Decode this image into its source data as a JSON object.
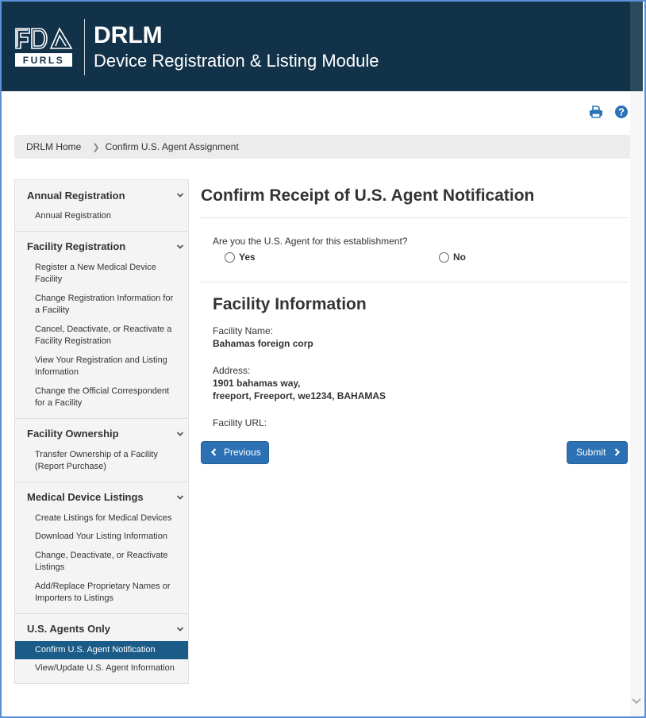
{
  "header": {
    "logo_top": "FDA",
    "logo_bottom": "FURLS",
    "title": "DRLM",
    "subtitle": "Device Registration & Listing Module"
  },
  "toolbar": {
    "print_icon": "print-icon",
    "help_icon": "help-icon"
  },
  "breadcrumb": {
    "items": [
      {
        "label": "DRLM Home"
      },
      {
        "label": "Confirm U.S. Agent Assignment"
      }
    ]
  },
  "sidebar": {
    "groups": [
      {
        "title": "Annual Registration",
        "items": [
          {
            "label": "Annual Registration"
          }
        ]
      },
      {
        "title": "Facility Registration",
        "items": [
          {
            "label": "Register a New Medical Device Facility"
          },
          {
            "label": "Change Registration Information for a Facility"
          },
          {
            "label": "Cancel, Deactivate, or Reactivate a Facility Registration"
          },
          {
            "label": "View Your Registration and Listing Information"
          },
          {
            "label": "Change the Official Correspondent for a Facility"
          }
        ]
      },
      {
        "title": "Facility Ownership",
        "items": [
          {
            "label": "Transfer Ownership of a Facility (Report Purchase)"
          }
        ]
      },
      {
        "title": "Medical Device Listings",
        "items": [
          {
            "label": "Create Listings for Medical Devices"
          },
          {
            "label": "Download Your Listing Information"
          },
          {
            "label": "Change, Deactivate, or Reactivate Listings"
          },
          {
            "label": "Add/Replace Proprietary Names or Importers to Listings"
          }
        ]
      },
      {
        "title": "U.S. Agents Only",
        "items": [
          {
            "label": "Confirm U.S. Agent Notification",
            "active": true
          },
          {
            "label": "View/Update U.S. Agent Information"
          }
        ]
      }
    ]
  },
  "main": {
    "title": "Confirm Receipt of U.S. Agent Notification",
    "question": "Are you the U.S. Agent for this establishment?",
    "options": [
      {
        "label": "Yes",
        "selected": false
      },
      {
        "label": "No",
        "selected": false
      }
    ],
    "facility": {
      "section_title": "Facility Information",
      "name_label": "Facility Name:",
      "name_value": "Bahamas foreign corp",
      "address_label": "Address:",
      "address_line1": "1901 bahamas way,",
      "address_line2": "freeport, Freeport, we1234, BAHAMAS",
      "url_label": "Facility URL:",
      "url_value": ""
    },
    "buttons": {
      "previous": "Previous",
      "submit": "Submit"
    }
  },
  "colors": {
    "header_bg": "#12324a",
    "accent": "#2b71b3",
    "active_nav": "#1b5b87"
  }
}
